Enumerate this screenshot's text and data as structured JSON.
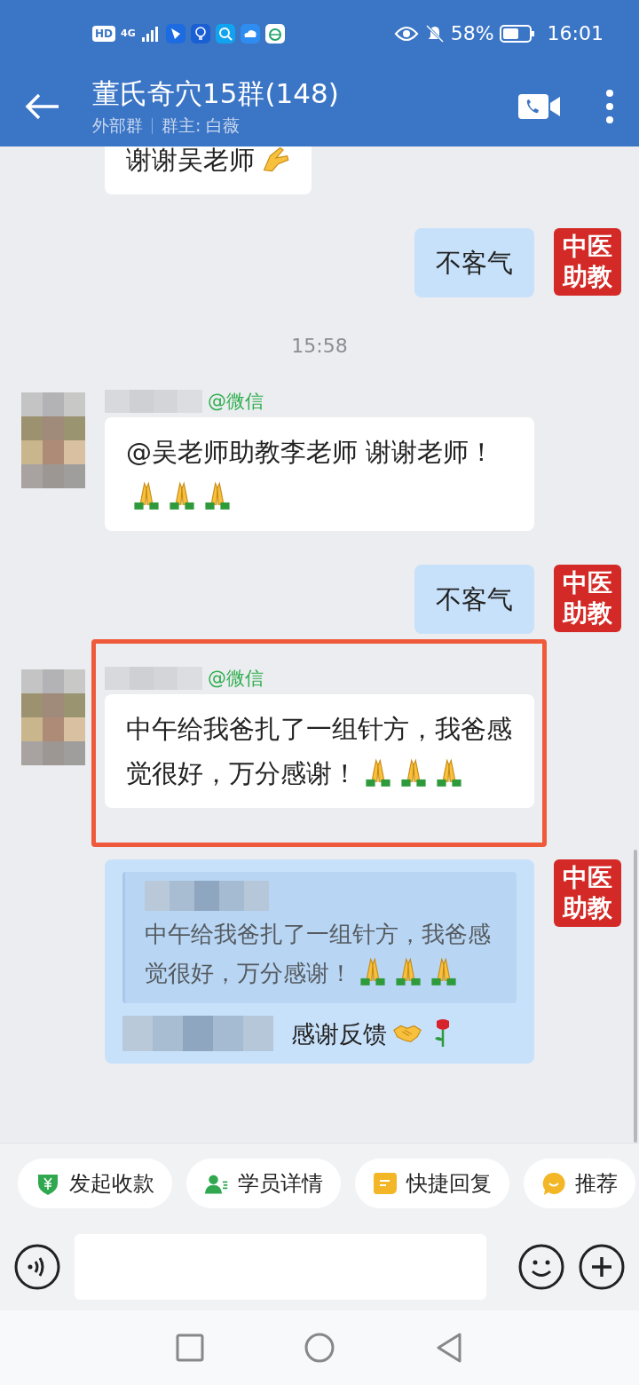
{
  "status_bar": {
    "hd": "HD",
    "network": "4G",
    "battery": "58%",
    "time": "16:01"
  },
  "header": {
    "title": "董氏奇穴15群(148)",
    "group_type": "外部群",
    "owner": "群主: 白薇"
  },
  "messages": [
    {
      "kind": "incoming",
      "text": "谢谢吴老师",
      "emojis": [
        {
          "kind": "ok"
        }
      ],
      "cut": true
    },
    {
      "kind": "outgoing",
      "text": "不客气",
      "avatar_text": "中医助教"
    },
    {
      "kind": "time",
      "text": "15:58"
    },
    {
      "kind": "incoming",
      "sender_tag": "@微信",
      "text": "@吴老师助教李老师 谢谢老师！",
      "emojis": [
        {
          "kind": "pray"
        },
        {
          "kind": "pray"
        },
        {
          "kind": "pray"
        }
      ]
    },
    {
      "kind": "outgoing",
      "text": "不客气",
      "avatar_text": "中医助教"
    },
    {
      "kind": "incoming",
      "sender_tag": "@微信",
      "text": "中午给我爸扎了一组针方，我爸感觉很好，万分感谢！",
      "emojis": [
        {
          "kind": "pray"
        },
        {
          "kind": "pray"
        },
        {
          "kind": "pray"
        }
      ],
      "highlighted": true
    },
    {
      "kind": "reply",
      "avatar_text": "中医助教",
      "quote": "中午给我爸扎了一组针方，我爸感觉很好，万分感谢！",
      "quote_emojis": [
        {
          "kind": "pray"
        },
        {
          "kind": "pray"
        },
        {
          "kind": "pray"
        }
      ],
      "text": "感谢反馈",
      "emojis": [
        {
          "kind": "handshake"
        },
        {
          "kind": "rose"
        }
      ]
    }
  ],
  "quick_actions": [
    {
      "kind": "payment",
      "label": "发起收款"
    },
    {
      "kind": "student",
      "label": "学员详情"
    },
    {
      "kind": "reply",
      "label": "快捷回复"
    },
    {
      "kind": "recommend",
      "label": "推荐"
    }
  ]
}
